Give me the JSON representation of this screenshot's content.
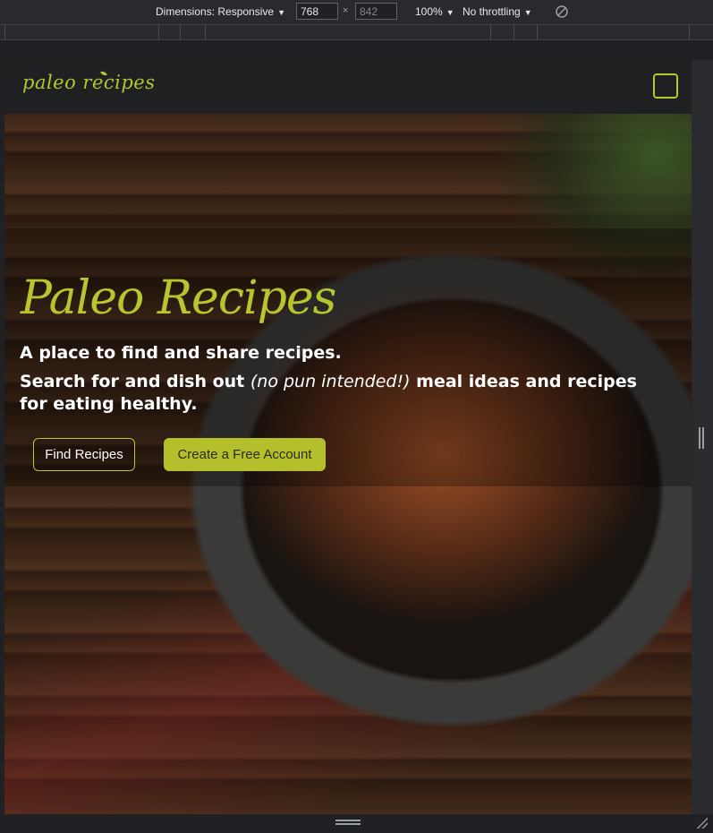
{
  "devtools": {
    "dimensions_label": "Dimensions: Responsive",
    "width_value": "768",
    "height_value": "842",
    "times": "×",
    "zoom_label": "100%",
    "throttling_label": "No throttling"
  },
  "site": {
    "logo_text": "paleo recipes",
    "menu_icon": "hamburger-menu-icon"
  },
  "hero": {
    "title": "Paleo Recipes",
    "line1": "A place to find and share recipes.",
    "line2_prefix": "Search for and dish out ",
    "line2_emphasis": "(no pun intended!)",
    "line2_suffix": " meal ideas and recipes for eating healthy.",
    "find_button": "Find Recipes",
    "create_button": "Create a Free Account"
  },
  "colors": {
    "accent": "#b7c52e",
    "header_bg": "#1f2022",
    "devtools_bg": "#292a2d"
  }
}
